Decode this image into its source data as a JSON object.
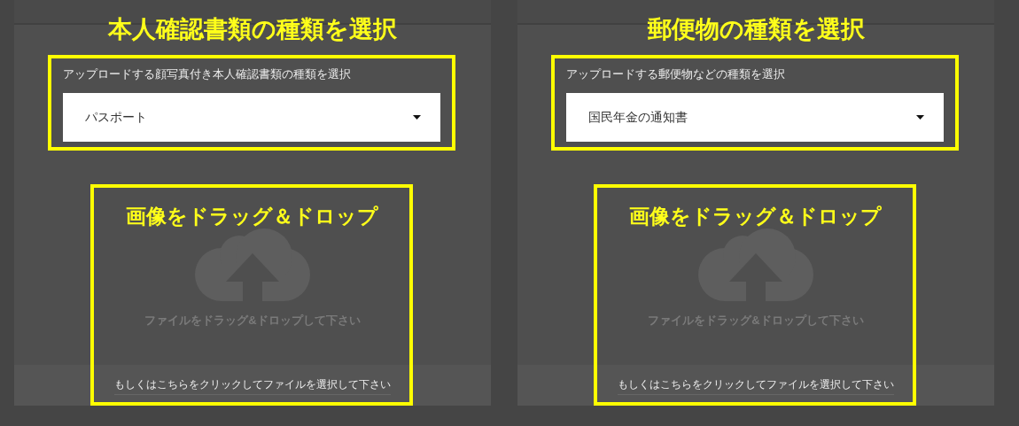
{
  "panels": [
    {
      "heading": "本人確認書類の種類を選択",
      "select_label": "アップロードする顔写真付き本人確認書類の種類を選択",
      "select_value": "パスポート",
      "drop_heading": "画像をドラッグ＆ドロップ",
      "drop_text": "ファイルをドラッグ&ドロップして下さい",
      "click_text": "もしくはこちらをクリックしてファイルを選択して下さい"
    },
    {
      "heading": "郵便物の種類を選択",
      "select_label": "アップロードする郵便物などの種類を選択",
      "select_value": "国民年金の通知書",
      "drop_heading": "画像をドラッグ＆ドロップ",
      "drop_text": "ファイルをドラッグ&ドロップして下さい",
      "click_text": "もしくはこちらをクリックしてファイルを選択して下さい"
    }
  ]
}
